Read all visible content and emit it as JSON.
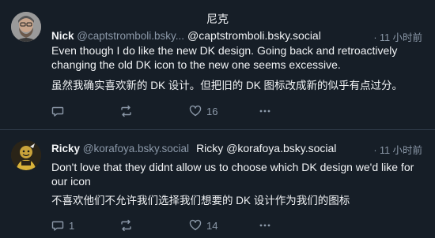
{
  "overlay": {
    "title": "尼克"
  },
  "posts": [
    {
      "author_name": "Nick",
      "handle": "@captstromboli.bsky...",
      "translated_header": "@captstromboli.bsky.social",
      "time": "· 11 小时前",
      "text_en": "Even though I do like the new DK design. Going back and retroactively changing the old DK icon to the new one seems excessive.",
      "text_zh": "虽然我确实喜欢新的 DK 设计。但把旧的 DK 图标改成新的似乎有点过分。",
      "reply_count": "",
      "repost_count": "",
      "like_count": "16"
    },
    {
      "author_name": "Ricky",
      "handle": "@korafoya.bsky.social",
      "translated_header": "Ricky @korafoya.bsky.social",
      "time": "· 11 小时前",
      "text_en": "Don't love that they didnt allow us to choose which DK design we'd like for our icon",
      "text_zh": "不喜欢他们不允许我们选择我们想要的 DK 设计作为我们的图标",
      "reply_count": "1",
      "repost_count": "",
      "like_count": "14"
    }
  ],
  "colors": {
    "background": "#161e27",
    "text": "#f1f3f5",
    "muted": "#8b98a8",
    "divider": "#2e3a48"
  },
  "icons": {
    "reply": "reply-icon",
    "repost": "repost-icon",
    "like": "heart-icon",
    "more": "more-icon"
  }
}
